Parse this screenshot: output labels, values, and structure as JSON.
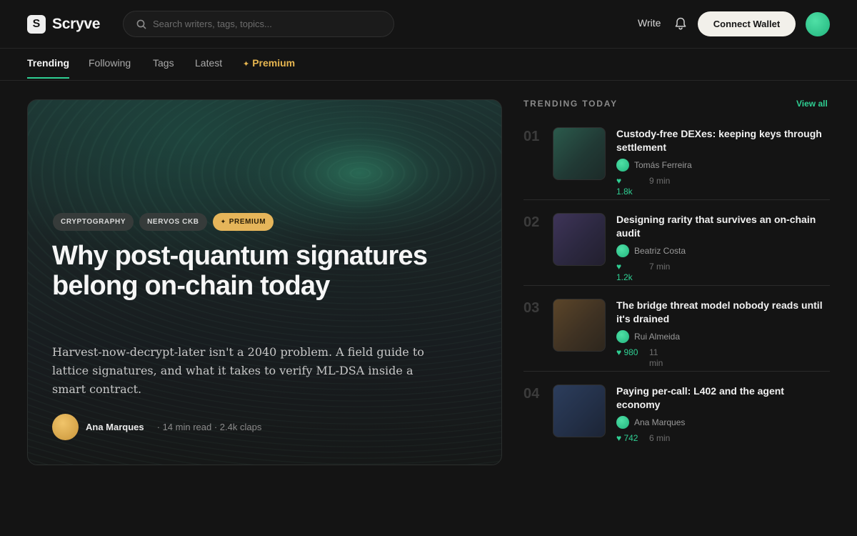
{
  "app": {
    "logo_letter": "S",
    "name": "Scryve"
  },
  "search": {
    "placeholder": "Search writers, tags, topics..."
  },
  "header": {
    "write_label": "Write",
    "connect_label": "Connect Wallet"
  },
  "tabs": [
    {
      "label": "Trending"
    },
    {
      "label": "Following"
    },
    {
      "label": "Tags"
    },
    {
      "label": "Latest"
    },
    {
      "label": "Premium",
      "icon": "✦"
    }
  ],
  "hero": {
    "tags": [
      "CRYPTOGRAPHY",
      "NERVOS CKB",
      "PREMIUM"
    ],
    "premium_icon": "✦",
    "title": "Why post-quantum signatures belong on-chain today",
    "summary": "Harvest-now-decrypt-later isn't a 2040 problem. A field guide to lattice signatures, and what it takes to verify ML-DSA inside a smart contract.",
    "author": "Ana Marques",
    "meta": "· 14 min read · 2.4k claps"
  },
  "trending": {
    "heading": "TRENDING TODAY",
    "view_all": "View all",
    "items": [
      {
        "rank": "01",
        "title": "Custody-free DEXes: keeping keys through settlement",
        "author": "Tomás Ferreira",
        "likes": "♥ 1.8k",
        "time": "9 min"
      },
      {
        "rank": "02",
        "title": "Designing rarity that survives an on-chain audit",
        "author": "Beatriz Costa",
        "likes": "♥ 1.2k",
        "time": "7 min"
      },
      {
        "rank": "03",
        "title": "The bridge threat model nobody reads until it's drained",
        "author": "Rui Almeida",
        "likes": "♥ 980",
        "time": "11 min"
      },
      {
        "rank": "04",
        "title": "Paying per-call: L402 and the agent economy",
        "author": "Ana Marques",
        "likes": "♥ 742",
        "time": "6 min"
      }
    ]
  },
  "colors": {
    "accent": "#2fcf93",
    "premium": "#e7b650",
    "background": "#141414"
  }
}
